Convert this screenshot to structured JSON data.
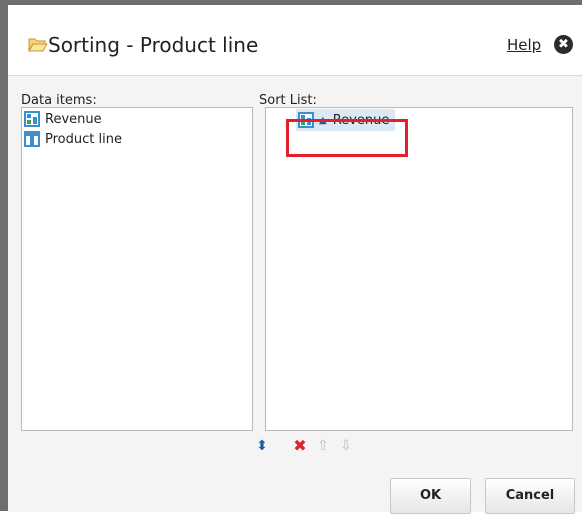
{
  "dialog": {
    "title": "Sorting - Product line",
    "help_label": "Help",
    "close_glyph": "✖"
  },
  "data_items": {
    "label": "Data items:",
    "items": [
      {
        "label": "Revenue",
        "icon": "measure-icon"
      },
      {
        "label": "Product line",
        "icon": "data-item-icon"
      }
    ]
  },
  "sort_list": {
    "label": "Sort List:",
    "items": [
      {
        "label": "Revenue",
        "icon": "measure-icon",
        "direction": "ascending"
      }
    ]
  },
  "toolbar": {
    "toggle_glyph": "⬍",
    "delete_glyph": "✖",
    "up_glyph": "⇧",
    "down_glyph": "⇩"
  },
  "buttons": {
    "ok_label": "OK",
    "cancel_label": "Cancel"
  },
  "colors": {
    "highlight": "#e2202b",
    "selected_bg": "#dce9f5",
    "accent_blue": "#1f5c99",
    "delete_red": "#d9232f"
  }
}
